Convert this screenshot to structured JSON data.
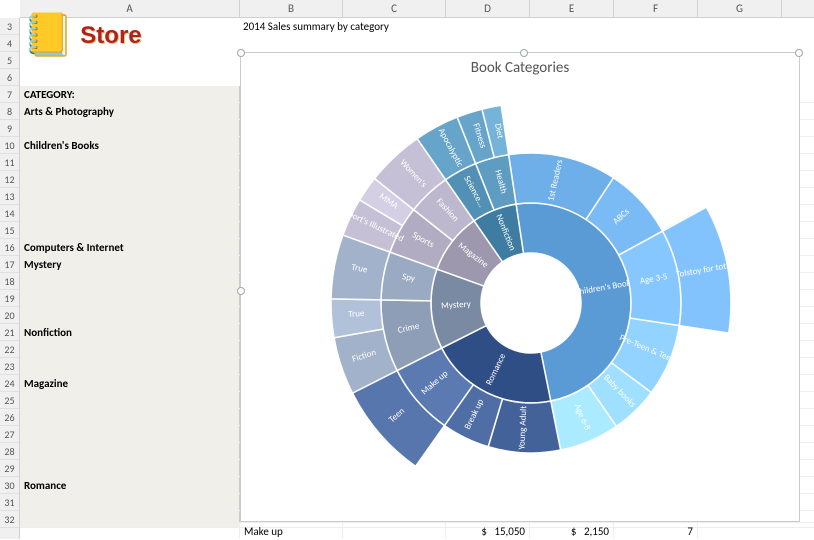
{
  "columns": [
    "A",
    "B",
    "C",
    "D",
    "E",
    "F",
    "G"
  ],
  "row_start": 3,
  "row_end": 32,
  "store_label": "Store",
  "title": "2014 Sales summary by category",
  "category_header": "CATEGORY:",
  "categories": {
    "r8": "Arts & Photography",
    "r10": "Children's Books",
    "r16": "Computers & Internet",
    "r17": "Mystery",
    "r21": "Nonfiction",
    "r24": "Magazine",
    "r30": "Romance"
  },
  "bottom_row": {
    "b": "Make up",
    "d_prefix": "$",
    "d": "15,050",
    "e_prefix": "$",
    "e": "2,150",
    "f": "7"
  },
  "chart": {
    "title": "Book Categories"
  },
  "chart_data": {
    "type": "sunburst",
    "title": "Book Categories",
    "series": [
      {
        "name": "Children's Books",
        "children": [
          {
            "name": "1st Readers",
            "value": 45
          },
          {
            "name": "ABCs",
            "value": 30
          },
          {
            "name": "Age 3-5",
            "children": [
              {
                "name": "Tolstoy for tots",
                "value": 40
              }
            ],
            "value": 40
          },
          {
            "name": "Pre-Teen & Teen",
            "value": 30
          },
          {
            "name": "Baby books",
            "value": 20
          },
          {
            "name": "Age 6-8",
            "value": 25
          }
        ]
      },
      {
        "name": "Romance",
        "children": [
          {
            "name": "Young Adult",
            "value": 30
          },
          {
            "name": "Break up",
            "value": 20
          },
          {
            "name": "Make up",
            "children": [
              {
                "name": "Teen",
                "value": 18
              }
            ],
            "value": 30
          }
        ]
      },
      {
        "name": "Mystery",
        "children": [
          {
            "name": "Crime",
            "children": [
              {
                "name": "Fiction",
                "value": 18
              },
              {
                "name": "True",
                "value": 12
              }
            ],
            "value": 30
          },
          {
            "name": "Spy",
            "children": [
              {
                "name": "True",
                "value": 12
              }
            ],
            "value": 20
          }
        ]
      },
      {
        "name": "Magazine",
        "children": [
          {
            "name": "Sports",
            "children": [
              {
                "name": "Sport's Illustrated",
                "value": 12
              },
              {
                "name": "MMA",
                "value": 8
              }
            ],
            "value": 20
          },
          {
            "name": "Fashion",
            "children": [
              {
                "name": "Women's",
                "value": 14
              }
            ],
            "value": 18
          }
        ]
      },
      {
        "name": "Nonfiction",
        "children": [
          {
            "name": "Science...",
            "children": [
              {
                "name": "Apocalyptic",
                "value": 10
              }
            ],
            "value": 14
          },
          {
            "name": "Health",
            "children": [
              {
                "name": "Fitness",
                "value": 8
              },
              {
                "name": "Diet",
                "value": 6
              }
            ],
            "value": 14
          }
        ]
      }
    ]
  }
}
